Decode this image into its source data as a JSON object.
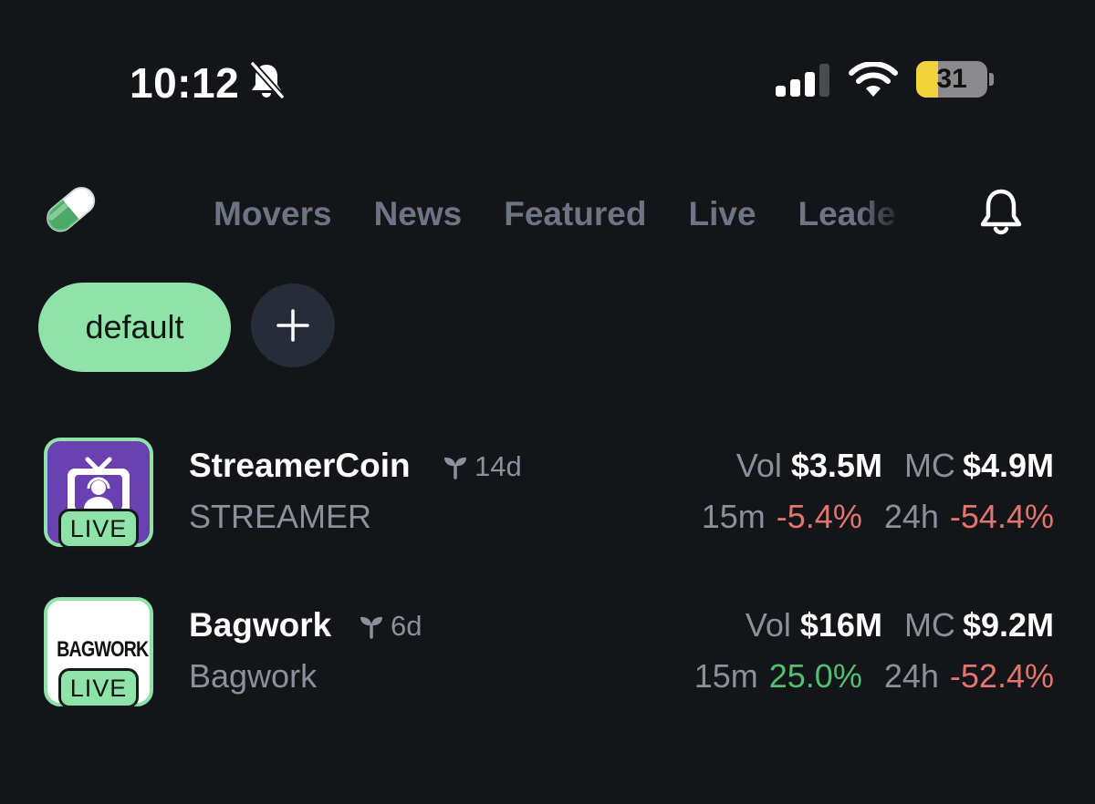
{
  "status_bar": {
    "time": "10:12",
    "battery": "31",
    "icons": [
      "bell-slash-icon",
      "cellular-signal-icon",
      "wifi-icon",
      "battery-icon"
    ]
  },
  "nav": {
    "logo_icon": "pill-icon",
    "tabs": [
      {
        "label": "Movers"
      },
      {
        "label": "News"
      },
      {
        "label": "Featured"
      },
      {
        "label": "Live"
      },
      {
        "label": "Leade"
      }
    ],
    "notifications_icon": "bell-icon"
  },
  "watchlists": {
    "active": "default",
    "add_icon": "plus-icon"
  },
  "coins": [
    {
      "name": "StreamerCoin",
      "age": "14d",
      "symbol": "STREAMER",
      "badge": "LIVE",
      "vol_label": "Vol",
      "vol": "$3.5M",
      "mc_label": "MC",
      "mc": "$4.9M",
      "m15_label": "15m",
      "m15": "-5.4%",
      "h24_label": "24h",
      "h24": "-54.4%"
    },
    {
      "name": "Bagwork",
      "age": "6d",
      "symbol": "Bagwork",
      "badge": "LIVE",
      "logo_text": "BAGWORK",
      "vol_label": "Vol",
      "vol": "$16M",
      "mc_label": "MC",
      "mc": "$9.2M",
      "m15_label": "15m",
      "m15": "25.0%",
      "h24_label": "24h",
      "h24": "-52.4%"
    }
  ],
  "colors": {
    "background": "#141519",
    "accent_green": "#8fe3a9",
    "positive": "#4fbf72",
    "negative": "#e3746f",
    "muted_text": "#8a909c",
    "tab_text": "#6d7483"
  }
}
